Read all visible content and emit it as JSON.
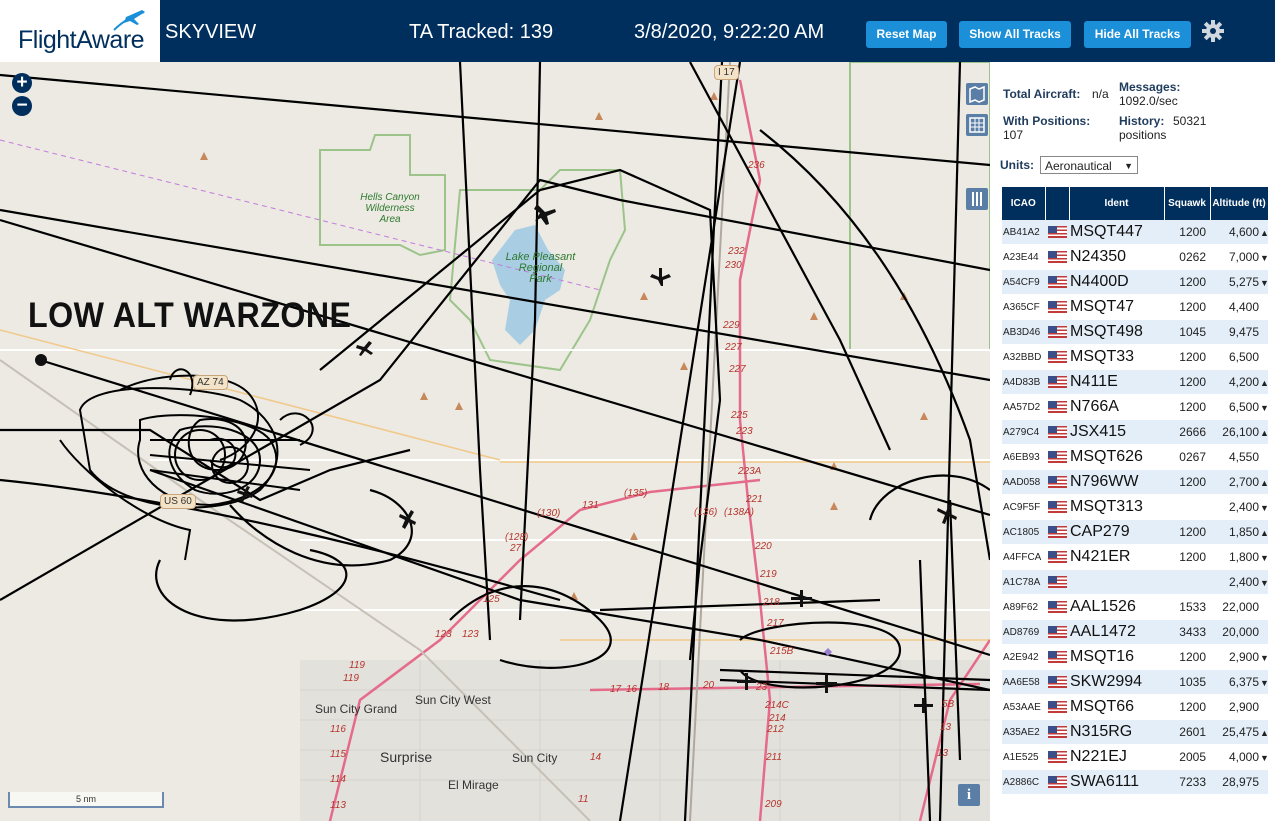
{
  "header": {
    "logo_text": "FlightAware",
    "app_title": "SKYVIEW",
    "tracked": "TA Tracked: 139",
    "datetime": "3/8/2020, 9:22:20 AM",
    "buttons": {
      "reset": "Reset Map",
      "show_all": "Show All Tracks",
      "hide_all": "Hide All Tracks"
    }
  },
  "map": {
    "zoom_in": "+",
    "zoom_out": "−",
    "annotation": "LOW ALT WARZONE",
    "places": {
      "hells_canyon": "Hells Canyon\nWilderness\nArea",
      "lake_pleasant": "Lake Pleasant\nRegional\nPark",
      "sun_city_grand": "Sun City Grand",
      "sun_city_west": "Sun City West",
      "surprise": "Surprise",
      "sun_city": "Sun City",
      "el_mirage": "El Mirage"
    },
    "shields": {
      "az74": "AZ 74",
      "us60": "US 60",
      "i17": "I 17"
    },
    "road_numbers": [
      "236",
      "232",
      "230",
      "229",
      "227",
      "227",
      "225",
      "223",
      "223A",
      "221",
      "220",
      "219",
      "218",
      "217",
      "215B",
      "214C",
      "214",
      "212",
      "211",
      "209",
      "(135)",
      "(136)",
      "(138A)",
      "131",
      "(130)",
      "(128)",
      "27",
      "125",
      "123",
      "123",
      "119",
      "119",
      "116",
      "115",
      "114",
      "113",
      "14",
      "13",
      "11",
      "16",
      "17",
      "18",
      "20",
      "23",
      "5B",
      "13"
    ],
    "scale": "5 nm",
    "info": "i"
  },
  "panel": {
    "total_aircraft_label": "Total Aircraft:",
    "total_aircraft_value": "n/a",
    "messages_label": "Messages:",
    "messages_value": "1092.0/sec",
    "with_positions_label": "With Positions:",
    "with_positions_value": "107",
    "history_label": "History:",
    "history_value": "50321 positions",
    "units_label": "Units:",
    "units_value": "Aeronautical",
    "columns": {
      "icao": "ICAO",
      "ident": "Ident",
      "squawk": "Squawk",
      "altitude": "Altitude (ft)"
    },
    "rows": [
      {
        "icao": "AB41A2",
        "ident": "MSQT447",
        "squawk": "1200",
        "alt": "4,600",
        "trend": "up"
      },
      {
        "icao": "A23E44",
        "ident": "N24350",
        "squawk": "0262",
        "alt": "7,000",
        "trend": "down"
      },
      {
        "icao": "A54CF9",
        "ident": "N4400D",
        "squawk": "1200",
        "alt": "5,275",
        "trend": "down"
      },
      {
        "icao": "A365CF",
        "ident": "MSQT47",
        "squawk": "1200",
        "alt": "4,400",
        "trend": ""
      },
      {
        "icao": "AB3D46",
        "ident": "MSQT498",
        "squawk": "1045",
        "alt": "9,475",
        "trend": ""
      },
      {
        "icao": "A32BBD",
        "ident": "MSQT33",
        "squawk": "1200",
        "alt": "6,500",
        "trend": ""
      },
      {
        "icao": "A4D83B",
        "ident": "N411E",
        "squawk": "1200",
        "alt": "4,200",
        "trend": "up"
      },
      {
        "icao": "AA57D2",
        "ident": "N766A",
        "squawk": "1200",
        "alt": "6,500",
        "trend": "down"
      },
      {
        "icao": "A279C4",
        "ident": "JSX415",
        "squawk": "2666",
        "alt": "26,100",
        "trend": "up"
      },
      {
        "icao": "A6EB93",
        "ident": "MSQT626",
        "squawk": "0267",
        "alt": "4,550",
        "trend": ""
      },
      {
        "icao": "AAD058",
        "ident": "N796WW",
        "squawk": "1200",
        "alt": "2,700",
        "trend": "up"
      },
      {
        "icao": "AC9F5F",
        "ident": "MSQT313",
        "squawk": "",
        "alt": "2,400",
        "trend": "down"
      },
      {
        "icao": "AC1805",
        "ident": "CAP279",
        "squawk": "1200",
        "alt": "1,850",
        "trend": "up"
      },
      {
        "icao": "A4FFCA",
        "ident": "N421ER",
        "squawk": "1200",
        "alt": "1,800",
        "trend": "down"
      },
      {
        "icao": "A1C78A",
        "ident": "",
        "squawk": "",
        "alt": "2,400",
        "trend": "down"
      },
      {
        "icao": "A89F62",
        "ident": "AAL1526",
        "squawk": "1533",
        "alt": "22,000",
        "trend": ""
      },
      {
        "icao": "AD8769",
        "ident": "AAL1472",
        "squawk": "3433",
        "alt": "20,000",
        "trend": ""
      },
      {
        "icao": "A2E942",
        "ident": "MSQT16",
        "squawk": "1200",
        "alt": "2,900",
        "trend": "down"
      },
      {
        "icao": "AA6E58",
        "ident": "SKW2994",
        "squawk": "1035",
        "alt": "6,375",
        "trend": "down"
      },
      {
        "icao": "A53AAE",
        "ident": "MSQT66",
        "squawk": "1200",
        "alt": "2,900",
        "trend": ""
      },
      {
        "icao": "A35AE2",
        "ident": "N315RG",
        "squawk": "2601",
        "alt": "25,475",
        "trend": "up"
      },
      {
        "icao": "A1E525",
        "ident": "N221EJ",
        "squawk": "2005",
        "alt": "4,000",
        "trend": "down"
      },
      {
        "icao": "A2886C",
        "ident": "SWA6111",
        "squawk": "7233",
        "alt": "28,975",
        "trend": ""
      }
    ]
  },
  "colors": {
    "header_bg": "#002f5d",
    "button_bg": "#1b8fd8",
    "map_bg": "#eceae3",
    "track": "#000000",
    "row_alt": "#e4eef8"
  }
}
